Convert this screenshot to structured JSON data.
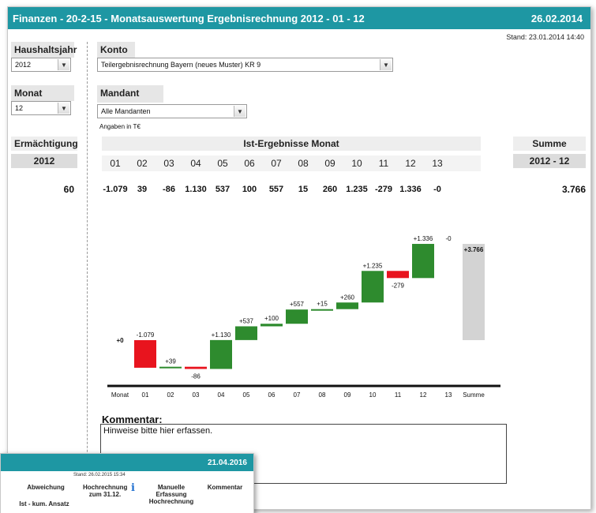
{
  "window": {
    "title": "Finanzen - 20-2-15 - Monatsauswertung Ergebnisrechnung 2012 - 01 - 12",
    "date": "26.02.2014",
    "stand": "Stand: 23.01.2014 14:40"
  },
  "filters": {
    "haushaltsjahr_label": "Haushaltsjahr",
    "haushaltsjahr_value": "2012",
    "monat_label": "Monat",
    "monat_value": "12",
    "konto_label": "Konto",
    "konto_value": "Teilergebnisrechnung Bayern (neues Muster)  KR 9",
    "mandant_label": "Mandant",
    "mandant_value": "Alle Mandanten",
    "angaben": "Angaben in T€"
  },
  "table": {
    "ermaechtigung_label": "Ermächtigung",
    "ermaechtigung_year": "2012",
    "ermaechtigung_value": "60",
    "ist_label": "Ist-Ergebnisse Monat",
    "summe_label": "Summe",
    "summe_period": "2012 - 12",
    "summe_value": "3.766",
    "months": [
      "01",
      "02",
      "03",
      "04",
      "05",
      "06",
      "07",
      "08",
      "09",
      "10",
      "11",
      "12",
      "13"
    ],
    "values": [
      "-1.079",
      "39",
      "-86",
      "1.130",
      "537",
      "100",
      "557",
      "15",
      "260",
      "1.235",
      "-279",
      "1.336",
      "-0"
    ]
  },
  "chart_data": {
    "type": "waterfall",
    "categories": [
      "Monat",
      "01",
      "02",
      "03",
      "04",
      "05",
      "06",
      "07",
      "08",
      "09",
      "10",
      "11",
      "12",
      "13",
      "Summe"
    ],
    "start_label": "+0",
    "deltas": [
      -1079,
      39,
      -86,
      1130,
      537,
      100,
      557,
      15,
      260,
      1235,
      -279,
      1336,
      0
    ],
    "labels": [
      "-1.079",
      "+39",
      "-86",
      "+1.130",
      "+537",
      "+100",
      "+557",
      "+15",
      "+260",
      "+1.235",
      "-279",
      "+1.336",
      "-0"
    ],
    "total": 3766,
    "total_label": "+3.766",
    "colors": {
      "positive": "#2e8b2e",
      "negative": "#e8141e",
      "total": "#d3d3d3",
      "axis": "#111111"
    }
  },
  "kommentar": {
    "label": "Kommentar:",
    "placeholder": "Hinweise bitte hier erfassen."
  },
  "overlay": {
    "date": "21.04.2016",
    "stand": "Stand: 26.02.2015 15:34",
    "col_abweichung": "Abweichung",
    "col_ist_kum": "Ist - kum. Ansatz",
    "col_hochrechnung": "Hochrechnung zum 31.12.",
    "col_manuelle": "Manuelle Erfassung Hochrechnung",
    "col_kommentar": "Kommentar",
    "info_icon": "i"
  }
}
